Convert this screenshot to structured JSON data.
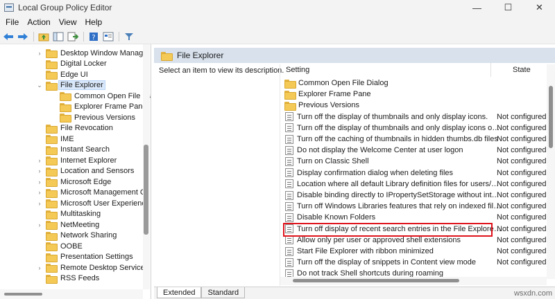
{
  "window": {
    "title": "Local Group Policy Editor",
    "minimize": "—",
    "maximize": "☐",
    "close": "✕"
  },
  "menu": [
    "File",
    "Action",
    "View",
    "Help"
  ],
  "tree": {
    "items": [
      {
        "label": "Desktop Window Manager",
        "level": 1,
        "chevron": "›"
      },
      {
        "label": "Digital Locker",
        "level": 1,
        "chevron": ""
      },
      {
        "label": "Edge UI",
        "level": 1,
        "chevron": ""
      },
      {
        "label": "File Explorer",
        "level": 1,
        "chevron": "⌄",
        "selected": true
      },
      {
        "label": "Common Open File Dia",
        "level": 2,
        "chevron": ""
      },
      {
        "label": "Explorer Frame Pane",
        "level": 2,
        "chevron": ""
      },
      {
        "label": "Previous Versions",
        "level": 2,
        "chevron": ""
      },
      {
        "label": "File Revocation",
        "level": 1,
        "chevron": ""
      },
      {
        "label": "IME",
        "level": 1,
        "chevron": ""
      },
      {
        "label": "Instant Search",
        "level": 1,
        "chevron": ""
      },
      {
        "label": "Internet Explorer",
        "level": 1,
        "chevron": "›"
      },
      {
        "label": "Location and Sensors",
        "level": 1,
        "chevron": "›"
      },
      {
        "label": "Microsoft Edge",
        "level": 1,
        "chevron": "›"
      },
      {
        "label": "Microsoft Management Cc",
        "level": 1,
        "chevron": "›"
      },
      {
        "label": "Microsoft User Experience",
        "level": 1,
        "chevron": "›"
      },
      {
        "label": "Multitasking",
        "level": 1,
        "chevron": ""
      },
      {
        "label": "NetMeeting",
        "level": 1,
        "chevron": "›"
      },
      {
        "label": "Network Sharing",
        "level": 1,
        "chevron": ""
      },
      {
        "label": "OOBE",
        "level": 1,
        "chevron": ""
      },
      {
        "label": "Presentation Settings",
        "level": 1,
        "chevron": ""
      },
      {
        "label": "Remote Desktop Services",
        "level": 1,
        "chevron": "›"
      },
      {
        "label": "RSS Feeds",
        "level": 1,
        "chevron": ""
      }
    ]
  },
  "details": {
    "header_title": "File Explorer",
    "description": "Select an item to view its description.",
    "col_setting": "Setting",
    "col_state": "State",
    "rows": [
      {
        "type": "folder",
        "setting": "Common Open File Dialog",
        "state": ""
      },
      {
        "type": "folder",
        "setting": "Explorer Frame Pane",
        "state": ""
      },
      {
        "type": "folder",
        "setting": "Previous Versions",
        "state": ""
      },
      {
        "type": "policy",
        "setting": "Turn off the display of thumbnails and only display icons.",
        "state": "Not configured"
      },
      {
        "type": "policy",
        "setting": "Turn off the display of thumbnails and only display icons on ...",
        "state": "Not configured"
      },
      {
        "type": "policy",
        "setting": "Turn off the caching of thumbnails in hidden thumbs.db files",
        "state": "Not configured"
      },
      {
        "type": "policy",
        "setting": "Do not display the Welcome Center at user logon",
        "state": "Not configured"
      },
      {
        "type": "policy",
        "setting": "Turn on Classic Shell",
        "state": "Not configured"
      },
      {
        "type": "policy",
        "setting": "Display confirmation dialog when deleting files",
        "state": "Not configured"
      },
      {
        "type": "policy",
        "setting": "Location where all default Library definition files for users/ma...",
        "state": "Not configured"
      },
      {
        "type": "policy",
        "setting": "Disable binding directly to IPropertySetStorage without inter...",
        "state": "Not configured"
      },
      {
        "type": "policy",
        "setting": "Turn off Windows Libraries features that rely on indexed file ...",
        "state": "Not configured"
      },
      {
        "type": "policy",
        "setting": "Disable Known Folders",
        "state": "Not configured"
      },
      {
        "type": "policy",
        "setting": "Turn off display of recent search entries in the File Explorer se...",
        "state": "Not configured"
      },
      {
        "type": "policy",
        "setting": "Allow only per user or approved shell extensions",
        "state": "Not configured"
      },
      {
        "type": "policy",
        "setting": "Start File Explorer with ribbon minimized",
        "state": "Not configured"
      },
      {
        "type": "policy",
        "setting": "Turn off the display of snippets in Content view mode",
        "state": "Not configured"
      },
      {
        "type": "policy",
        "setting": "Do not track Shell shortcuts during roaming",
        "state": ""
      }
    ]
  },
  "tabs": {
    "extended": "Extended",
    "standard": "Standard"
  },
  "watermark": "wsxdn.com",
  "colors": {
    "highlight": "#e0121c",
    "header_band": "#d8e1ec",
    "folder": "#f4c955"
  }
}
